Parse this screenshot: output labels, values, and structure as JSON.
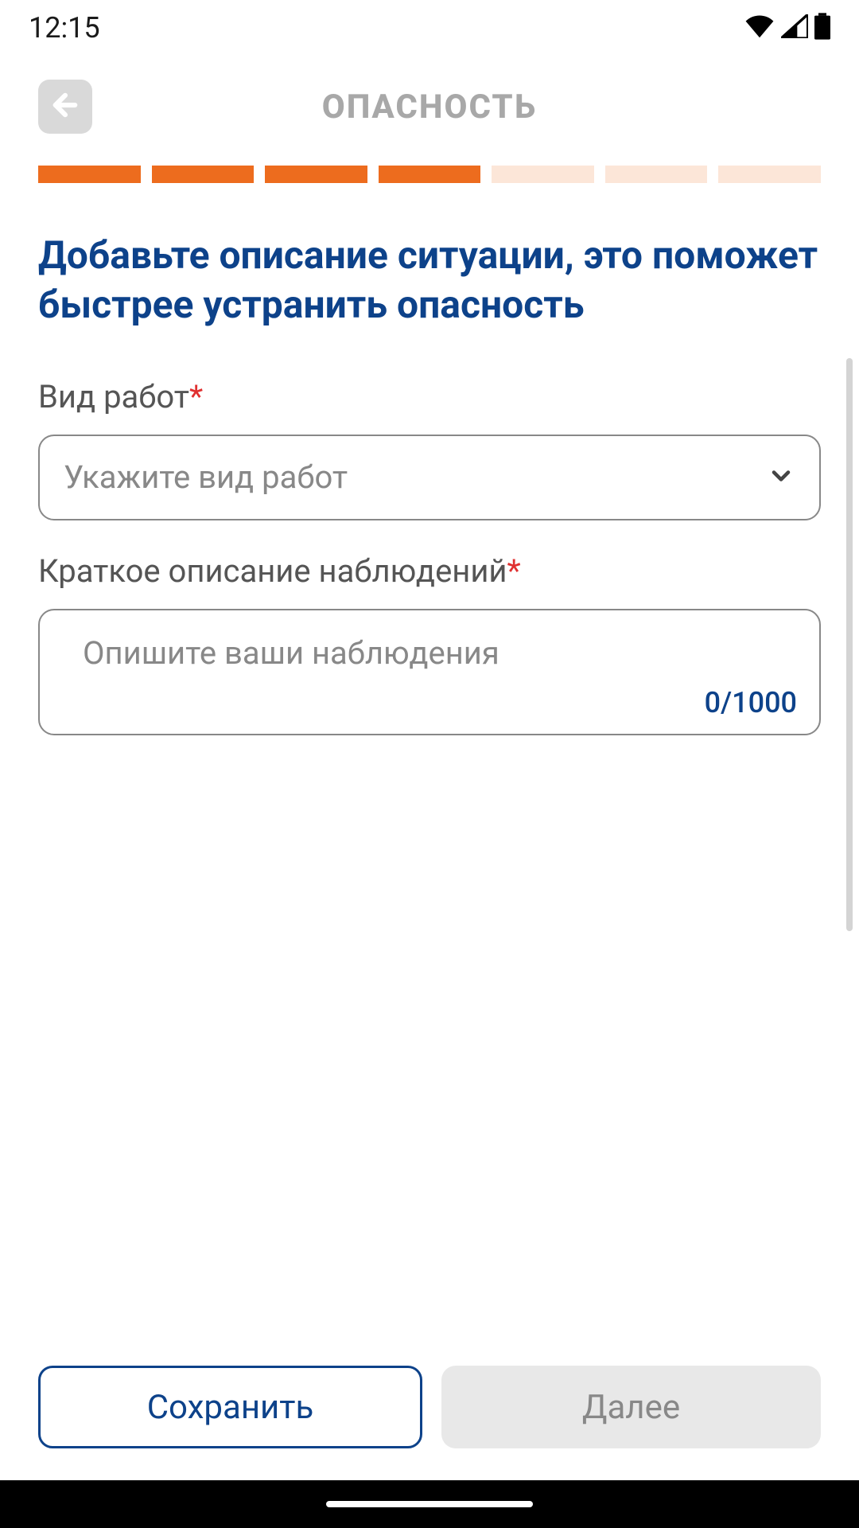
{
  "status_bar": {
    "time": "12:15"
  },
  "header": {
    "title": "ОПАСНОСТЬ"
  },
  "progress": {
    "total_segments": 7,
    "filled_segments": 4
  },
  "heading": "Добавьте описание ситуации, это поможет быстрее устранить опасность",
  "fields": {
    "work_type": {
      "label": "Вид работ",
      "placeholder": "Укажите вид работ",
      "required": true
    },
    "description": {
      "label": "Краткое описание наблюдений",
      "placeholder": "Опишите ваши наблюдения",
      "required": true,
      "char_count": "0/1000"
    }
  },
  "buttons": {
    "save": "Сохранить",
    "next": "Далее"
  },
  "required_mark": "*"
}
